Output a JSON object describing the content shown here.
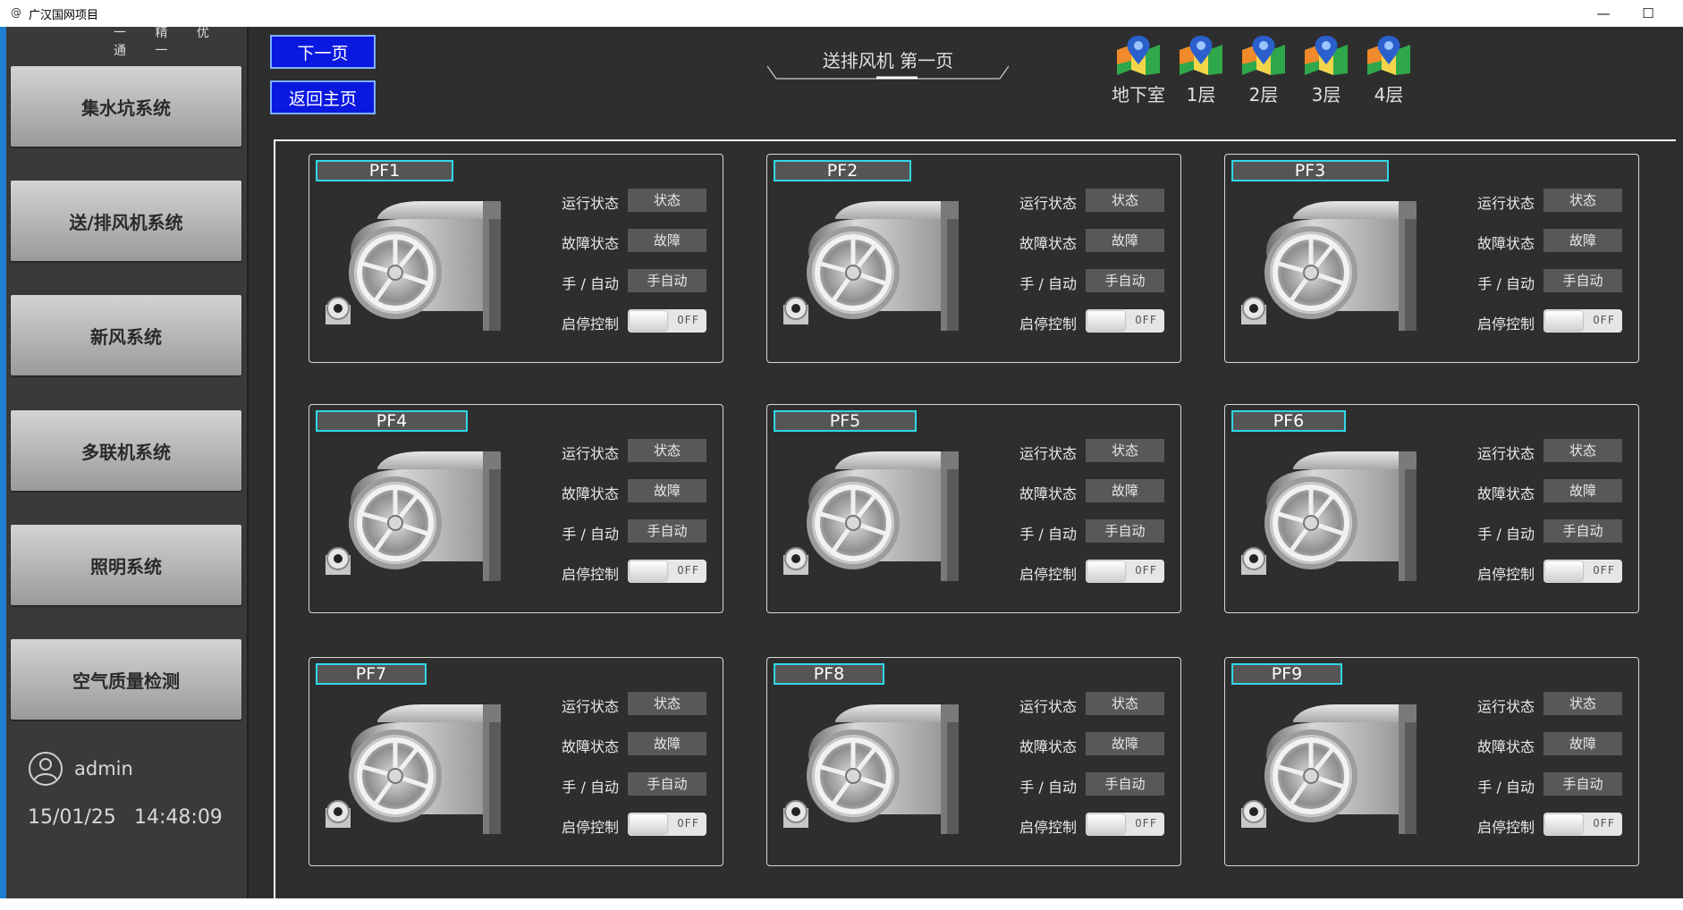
{
  "window": {
    "title": "广汉国网项目",
    "minimize": "—",
    "maximize": "☐"
  },
  "sidebar": {
    "logo_text": "一 精 优 通 一",
    "nav": [
      "集水坑系统",
      "送/排风机系统",
      "新风系统",
      "多联机系统",
      "照明系统",
      "空气质量检测"
    ],
    "user": "admin",
    "date": "15/01/25",
    "time": "14:48:09"
  },
  "header": {
    "next_page": "下一页",
    "home": "返回主页",
    "title": "送排风机 第一页",
    "floors": [
      "地下室",
      "1层",
      "2层",
      "3层",
      "4层"
    ]
  },
  "labels": {
    "run": "运行状态",
    "fault": "故障状态",
    "mode": "手 / 自动",
    "ctrl": "启停控制"
  },
  "fans": [
    {
      "name": "PF1",
      "run": "状态",
      "fault": "故障",
      "mode": "手自动",
      "switch": "OFF"
    },
    {
      "name": "PF2",
      "run": "状态",
      "fault": "故障",
      "mode": "手自动",
      "switch": "OFF"
    },
    {
      "name": "PF3",
      "run": "状态",
      "fault": "故障",
      "mode": "手自动",
      "switch": "OFF"
    },
    {
      "name": "PF4",
      "run": "状态",
      "fault": "故障",
      "mode": "手自动",
      "switch": "OFF"
    },
    {
      "name": "PF5",
      "run": "状态",
      "fault": "故障",
      "mode": "手自动",
      "switch": "OFF"
    },
    {
      "name": "PF6",
      "run": "状态",
      "fault": "故障",
      "mode": "手自动",
      "switch": "OFF"
    },
    {
      "name": "PF7",
      "run": "状态",
      "fault": "故障",
      "mode": "手自动",
      "switch": "OFF"
    },
    {
      "name": "PF8",
      "run": "状态",
      "fault": "故障",
      "mode": "手自动",
      "switch": "OFF"
    },
    {
      "name": "PF9",
      "run": "状态",
      "fault": "故障",
      "mode": "手自动",
      "switch": "OFF"
    }
  ]
}
